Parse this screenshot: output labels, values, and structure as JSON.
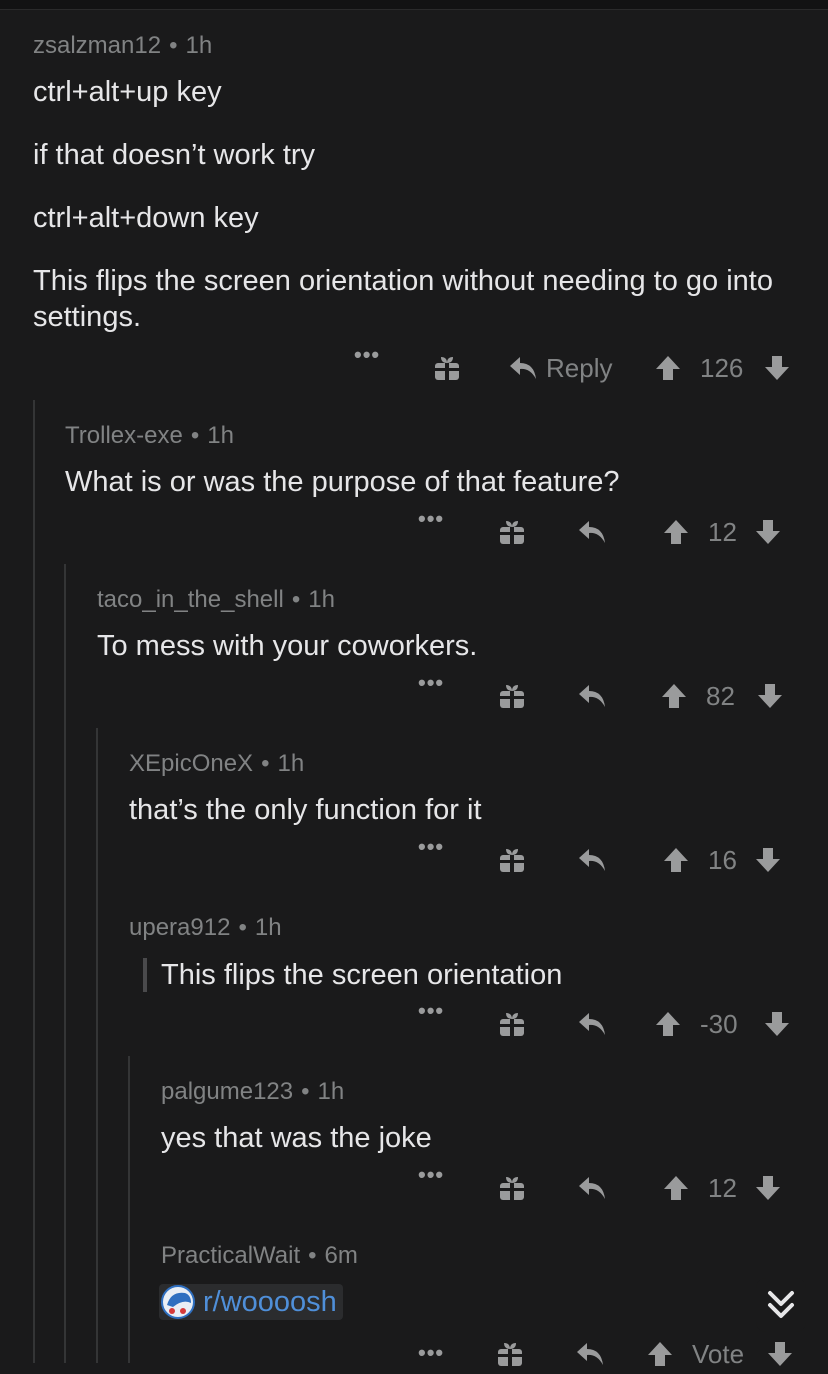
{
  "comments": [
    {
      "author": "zsalzman12",
      "time": "1h",
      "paragraphs": [
        "ctrl+alt+up key",
        "if that doesn’t work try",
        "ctrl+alt+down key",
        "This flips the screen orientation without needing to go into settings."
      ],
      "reply_label": "Reply",
      "score": "126"
    },
    {
      "author": "Trollex-exe",
      "time": "1h",
      "text": "What is or was the purpose of that feature?",
      "score": "12"
    },
    {
      "author": "taco_in_the_shell",
      "time": "1h",
      "text": "To mess with your coworkers.",
      "score": "82"
    },
    {
      "author": "XEpicOneX",
      "time": "1h",
      "text": "that’s the only function for it",
      "score": "16"
    },
    {
      "author": "upera912",
      "time": "1h",
      "quote": "This flips the screen orientation",
      "score": "-30"
    },
    {
      "author": "palgume123",
      "time": "1h",
      "text": "yes that was the joke",
      "score": "12"
    },
    {
      "author": "PracticalWait",
      "time": "6m",
      "link": "r/woooosh",
      "score": "Vote"
    }
  ],
  "icons": {
    "more": "more-options-icon",
    "award": "gift-award-icon",
    "reply": "reply-arrow-icon",
    "upvote": "upvote-arrow-icon",
    "downvote": "downvote-arrow-icon",
    "subreddit": "subreddit-avatar-icon",
    "scroll": "double-chevron-down-icon"
  },
  "colors": {
    "background": "#1a1a1b",
    "text": "#e6e6e8",
    "meta": "#818384",
    "link": "#4f8fd9",
    "thread_line": "#343536"
  }
}
